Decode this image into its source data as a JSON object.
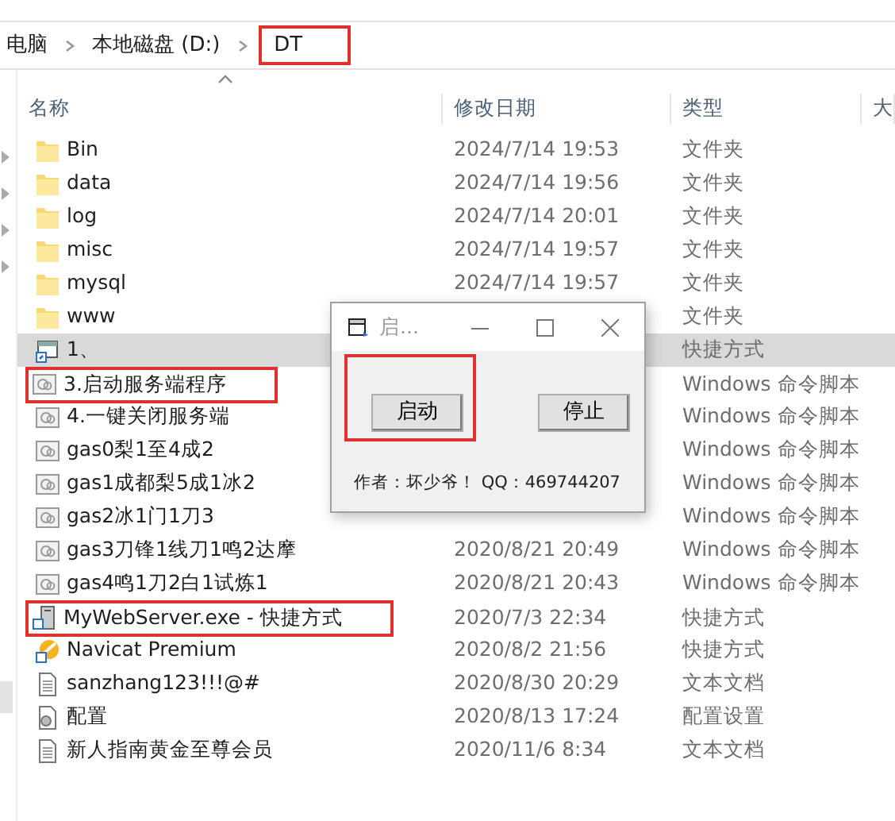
{
  "breadcrumb": [
    {
      "label": "电脑",
      "highlighted": false
    },
    {
      "label": "本地磁盘 (D:)",
      "highlighted": false
    },
    {
      "label": "DT",
      "highlighted": true
    }
  ],
  "columns": [
    "名称",
    "修改日期",
    "类型",
    "大"
  ],
  "files": [
    {
      "kind": "folder",
      "name": "Bin",
      "date": "2024/7/14 19:53",
      "type": "文件夹",
      "selected": false,
      "highlighted": false
    },
    {
      "kind": "folder",
      "name": "data",
      "date": "2024/7/14 19:56",
      "type": "文件夹",
      "selected": false,
      "highlighted": false
    },
    {
      "kind": "folder",
      "name": "log",
      "date": "2024/7/14 20:01",
      "type": "文件夹",
      "selected": false,
      "highlighted": false
    },
    {
      "kind": "folder",
      "name": "misc",
      "date": "2024/7/14 19:57",
      "type": "文件夹",
      "selected": false,
      "highlighted": false
    },
    {
      "kind": "folder",
      "name": "mysql",
      "date": "2024/7/14 19:57",
      "type": "文件夹",
      "selected": false,
      "highlighted": false
    },
    {
      "kind": "folder",
      "name": "www",
      "type": "文件夹",
      "selected": false,
      "highlighted": false
    },
    {
      "kind": "shortcut",
      "name": "1、",
      "type": "快捷方式",
      "selected": true,
      "highlighted": false
    },
    {
      "kind": "script",
      "name": "3.启动服务端程序",
      "type": "Windows 命令脚本",
      "selected": false,
      "highlighted": true
    },
    {
      "kind": "script",
      "name": "4.一键关闭服务端",
      "type": "Windows 命令脚本",
      "selected": false,
      "highlighted": false
    },
    {
      "kind": "script",
      "name": "gas0梨1至4成2",
      "type": "Windows 命令脚本",
      "selected": false,
      "highlighted": false
    },
    {
      "kind": "script",
      "name": "gas1成都梨5成1冰2",
      "type": "Windows 命令脚本",
      "selected": false,
      "highlighted": false
    },
    {
      "kind": "script",
      "name": "gas2冰1门1刀3",
      "type": "Windows 命令脚本",
      "selected": false,
      "highlighted": false
    },
    {
      "kind": "script",
      "name": "gas3刀锋1线刀1鸣2达摩",
      "date": "2020/8/21 20:49",
      "type": "Windows 命令脚本",
      "selected": false,
      "highlighted": false
    },
    {
      "kind": "script",
      "name": "gas4鸣1刀2白1试炼1",
      "date": "2020/8/21 20:43",
      "type": "Windows 命令脚本",
      "selected": false,
      "highlighted": false
    },
    {
      "kind": "exe",
      "name": "MyWebServer.exe - 快捷方式",
      "date": "2020/7/3 22:34",
      "type": "快捷方式",
      "selected": false,
      "highlighted": true
    },
    {
      "kind": "app",
      "name": "Navicat Premium",
      "date": "2020/8/2 21:56",
      "type": "快捷方式",
      "selected": false,
      "highlighted": false
    },
    {
      "kind": "text",
      "name": "sanzhang123!!!@#",
      "date": "2020/8/30 20:29",
      "type": "文本文档",
      "selected": false,
      "highlighted": false
    },
    {
      "kind": "config",
      "name": "配置",
      "date": "2020/8/13 17:24",
      "type": "配置设置",
      "selected": false,
      "highlighted": false
    },
    {
      "kind": "text",
      "name": "新人指南黄金至尊会员",
      "date": "2020/11/6 8:34",
      "type": "文本文档",
      "selected": false,
      "highlighted": false
    }
  ],
  "dialog": {
    "title": "启...",
    "buttons": [
      {
        "label": "启动",
        "highlighted": true
      },
      {
        "label": "停止",
        "highlighted": false
      }
    ],
    "note": "作者：坏少爷！ QQ：469744207"
  }
}
